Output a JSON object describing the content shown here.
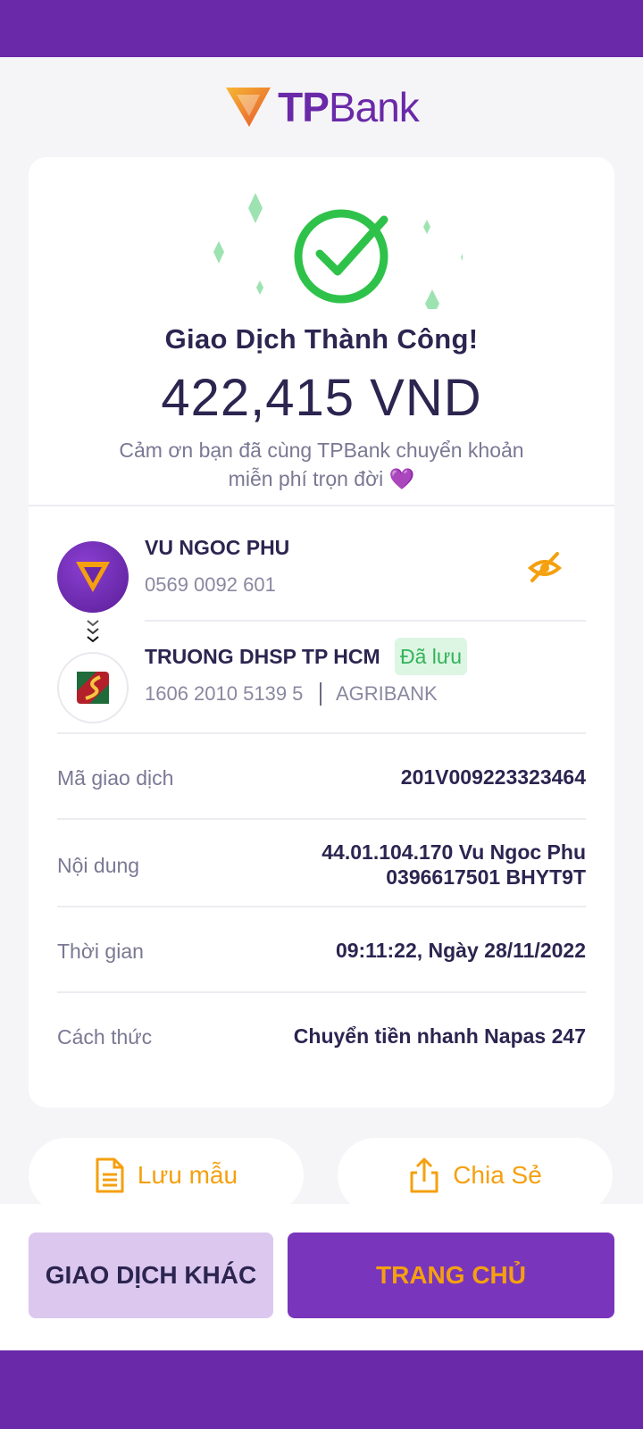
{
  "brand": {
    "logo_tp": "TP",
    "logo_bank": "Bank"
  },
  "result": {
    "title": "Giao Dịch Thành Công!",
    "amount": "422,415 VND",
    "thanks_line1": "Cảm ơn bạn đã cùng TPBank chuyển khoản",
    "thanks_line2": "miễn phí trọn đời 💜"
  },
  "sender": {
    "name": "VU NGOC PHU",
    "account": "0569 0092 601"
  },
  "receiver": {
    "name": "TRUONG DHSP TP HCM",
    "badge": "Đã lưu",
    "account": "1606 2010 5139 5",
    "bank": "AGRIBANK"
  },
  "details": {
    "txn_id_label": "Mã giao dịch",
    "txn_id_value": "201V009223323464",
    "content_label": "Nội dung",
    "content_line1": "44.01.104.170 Vu Ngoc Phu",
    "content_line2": "0396617501 BHYT9T",
    "time_label": "Thời gian",
    "time_value": "09:11:22, Ngày 28/11/2022",
    "method_label": "Cách thức",
    "method_value": "Chuyển tiền nhanh Napas 247"
  },
  "actions": {
    "save_template": "Lưu mẫu",
    "share": "Chia Sẻ",
    "other_txn": "GIAO DỊCH KHÁC",
    "home": "TRANG CHỦ"
  },
  "colors": {
    "purple": "#6a29a8",
    "orange": "#f5a00f",
    "success_green": "#2fc24a",
    "saved_badge_bg": "#dcf6e3"
  }
}
